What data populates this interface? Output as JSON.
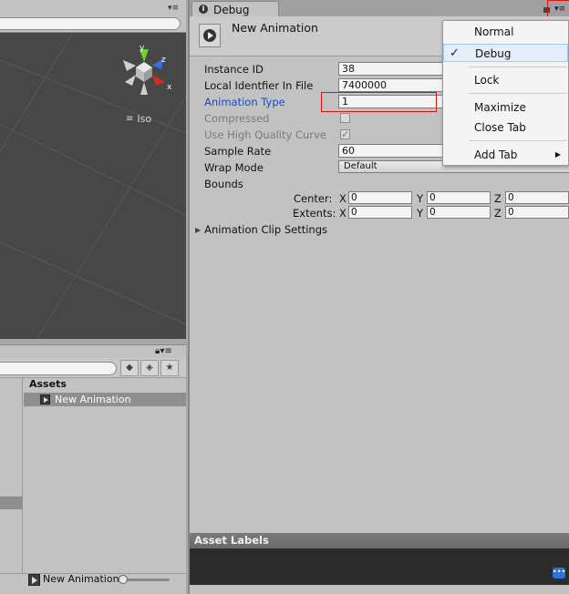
{
  "scene": {
    "projection_label": "Iso",
    "gizmo_axes": [
      "y",
      "z",
      "x"
    ]
  },
  "project": {
    "assets_header": "Assets",
    "asset_item": "New Animation",
    "bottom_selected": "New Animation"
  },
  "inspector": {
    "tab_label": "Debug",
    "title": "New Animation",
    "properties": {
      "instance_id_label": "Instance ID",
      "instance_id_value": "38",
      "local_id_label": "Local Identfier In File",
      "local_id_value": "7400000",
      "animation_type_label": "Animation Type",
      "animation_type_value": "1",
      "compressed_label": "Compressed",
      "hq_curve_label": "Use High Quality Curve",
      "sample_rate_label": "Sample Rate",
      "sample_rate_value": "60",
      "wrap_mode_label": "Wrap Mode",
      "wrap_mode_value": "Default",
      "bounds_label": "Bounds"
    },
    "bounds": {
      "center_label": "Center:",
      "extents_label": "Extents:",
      "axis_x": "X",
      "axis_y": "Y",
      "axis_z": "Z",
      "center": {
        "x": "0",
        "y": "0",
        "z": "0"
      },
      "extents": {
        "x": "0",
        "y": "0",
        "z": "0"
      }
    },
    "clip_settings_label": "Animation Clip Settings",
    "asset_labels_header": "Asset Labels"
  },
  "context_menu": {
    "items": [
      "Normal",
      "Debug",
      "Lock",
      "Maximize",
      "Close Tab",
      "Add Tab"
    ],
    "checked": "Debug"
  },
  "colors": {
    "scene_bg": "#474747",
    "panel_bg": "#c2c2c2",
    "highlight_red": "#e01010",
    "label_blue": "#1a4ac8",
    "selection_gray": "#8f8f8f"
  }
}
